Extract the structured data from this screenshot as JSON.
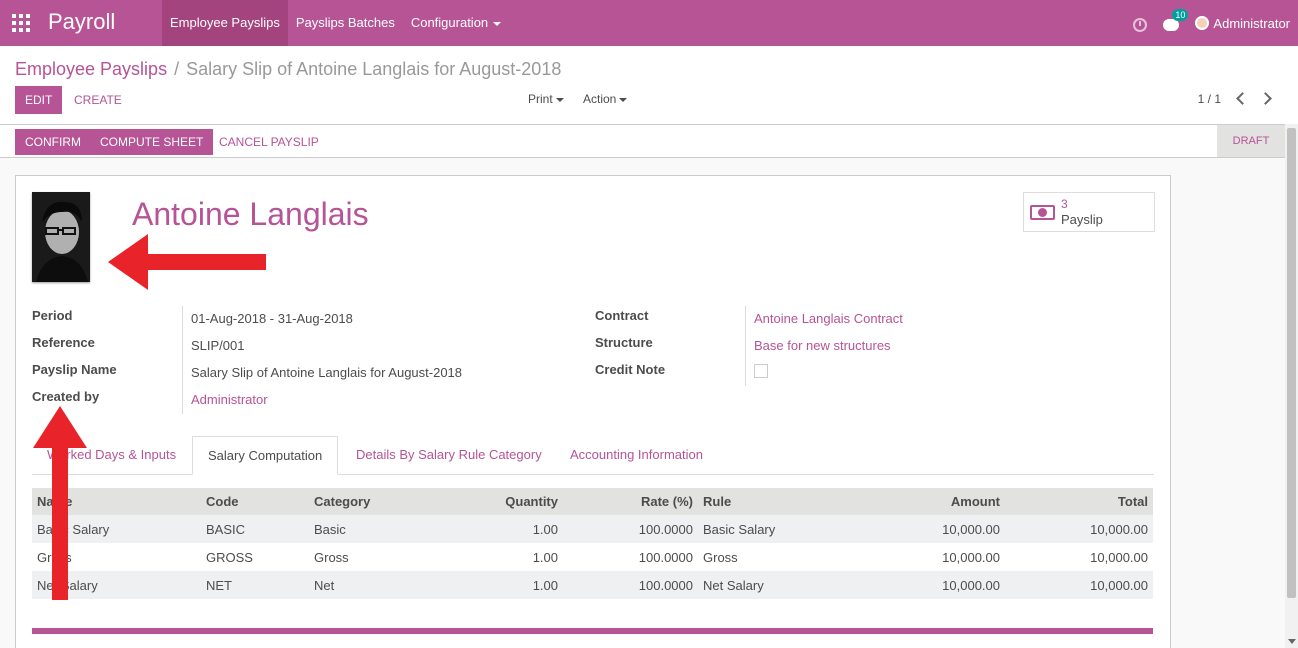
{
  "topnav": {
    "brand": "Payroll",
    "menu": [
      {
        "label": "Employee Payslips",
        "active": true
      },
      {
        "label": "Payslips Batches"
      },
      {
        "label": "Configuration"
      }
    ],
    "chat_count": "10",
    "user": "Administrator",
    "accent_color": "#b65496"
  },
  "breadcrumb": {
    "parent": "Employee Payslips",
    "current": "Salary Slip of Antoine Langlais for August-2018"
  },
  "controls": {
    "edit": "Edit",
    "create": "Create",
    "print": "Print",
    "action": "Action",
    "pager": "1 / 1"
  },
  "statusbar": {
    "confirm": "Confirm",
    "compute": "Compute Sheet",
    "cancel": "Cancel Payslip",
    "state": "Draft"
  },
  "employee": {
    "name": "Antoine Langlais",
    "payslip_count": "3",
    "payslip_label": "Payslip"
  },
  "fields_left": [
    {
      "label": "Period",
      "value": "01-Aug-2018 - 31-Aug-2018"
    },
    {
      "label": "Reference",
      "value": "SLIP/001"
    },
    {
      "label": "Payslip Name",
      "value": "Salary Slip of Antoine Langlais for August-2018"
    },
    {
      "label": "Created by",
      "value": "Administrator"
    }
  ],
  "fields_right": [
    {
      "label": "Contract",
      "value": "Antoine Langlais Contract"
    },
    {
      "label": "Structure",
      "value": "Base for new structures"
    },
    {
      "label": "Credit Note",
      "value": ""
    }
  ],
  "tabs": [
    {
      "label": "Worked Days & Inputs"
    },
    {
      "label": "Salary Computation",
      "active": true
    },
    {
      "label": "Details By Salary Rule Category"
    },
    {
      "label": "Accounting Information"
    }
  ],
  "table": {
    "headers": [
      "Name",
      "Code",
      "Category",
      "Quantity",
      "Rate (%)",
      "Rule",
      "Amount",
      "Total"
    ],
    "rows": [
      [
        "Basic Salary",
        "BASIC",
        "Basic",
        "1.00",
        "100.0000",
        "Basic Salary",
        "10,000.00",
        "10,000.00"
      ],
      [
        "Gross",
        "GROSS",
        "Gross",
        "1.00",
        "100.0000",
        "Gross",
        "10,000.00",
        "10,000.00"
      ],
      [
        "Net Salary",
        "NET",
        "Net",
        "1.00",
        "100.0000",
        "Net Salary",
        "10,000.00",
        "10,000.00"
      ]
    ]
  }
}
